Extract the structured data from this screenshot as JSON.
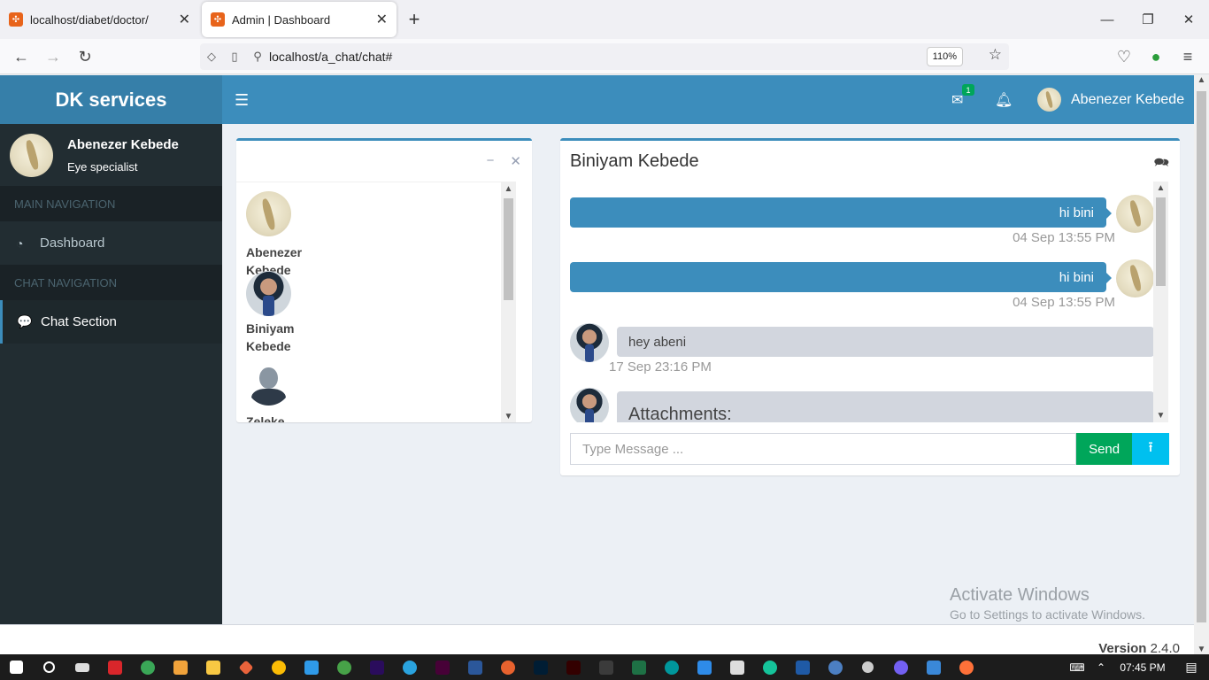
{
  "browser": {
    "tabs": [
      {
        "label": "localhost/diabet/doctor/",
        "active": false
      },
      {
        "label": "Admin | Dashboard",
        "active": true
      }
    ],
    "new_tab": "+",
    "url": "localhost/a_chat/chat#",
    "zoom": "110%"
  },
  "app": {
    "brand": "DK services",
    "user": {
      "name": "Abenezer Kebede",
      "role": "Eye specialist"
    },
    "nav": {
      "main_header": "MAIN NAVIGATION",
      "dashboard": "Dashboard",
      "chat_header": "CHAT NAVIGATION",
      "chat_section": "Chat Section"
    },
    "header": {
      "mail_badge": "1",
      "user_name": "Abenezer Kebede"
    }
  },
  "contacts": {
    "items": [
      {
        "first": "Abenezer",
        "last": "Kebede",
        "avatar": "sketch"
      },
      {
        "first": "Biniyam",
        "last": "Kebede",
        "avatar": "photo"
      },
      {
        "first": "Zeleke",
        "last": "",
        "avatar": "default"
      }
    ]
  },
  "chat": {
    "title": "Biniyam Kebede",
    "messages": [
      {
        "side": "right",
        "text": "hi bini",
        "time": "04 Sep 13:55 PM"
      },
      {
        "side": "right",
        "text": "hi bini",
        "time": "04 Sep 13:55 PM"
      },
      {
        "side": "left",
        "text": "hey abeni",
        "time": "17 Sep 23:16 PM"
      },
      {
        "side": "left",
        "text": "Attachments:",
        "time": ""
      }
    ],
    "input_placeholder": "Type Message ...",
    "send_label": "Send"
  },
  "footer": {
    "version_label": "Version",
    "version": "2.4.0"
  },
  "watermark": {
    "line1": "Activate Windows",
    "line2": "Go to Settings to activate Windows."
  },
  "taskbar": {
    "time": "07:45 PM"
  }
}
